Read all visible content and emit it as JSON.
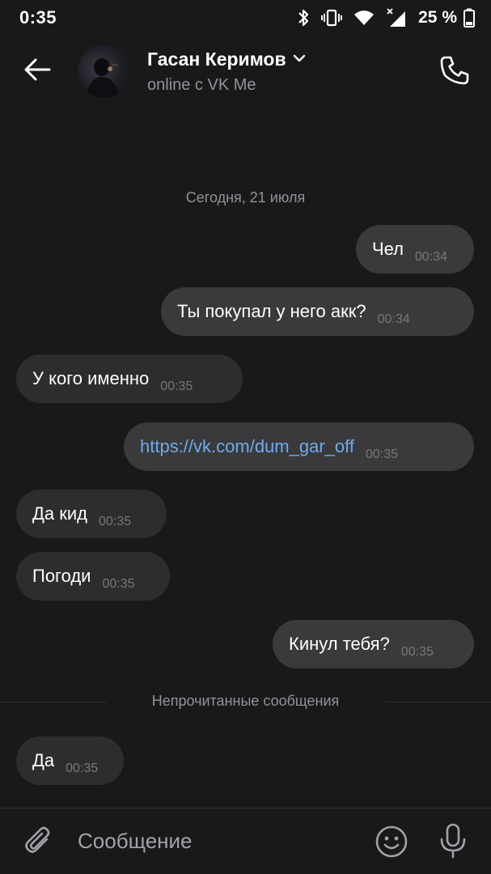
{
  "status_bar": {
    "time": "0:35",
    "battery_percent": "25 %",
    "icons": [
      "bluetooth-icon",
      "vibrate-icon",
      "wifi-icon",
      "cell-signal-icon",
      "battery-icon"
    ]
  },
  "header": {
    "contact_name": "Гасан Керимов",
    "contact_status": "online с VK Me",
    "icons": [
      "back-arrow-icon",
      "chevron-down-icon",
      "phone-icon"
    ]
  },
  "chat": {
    "date_separator": "Сегодня, 21 июля",
    "messages": [
      {
        "direction": "out",
        "text": "Чел",
        "time": "00:34"
      },
      {
        "direction": "out",
        "text": "Ты покупал у него акк?",
        "time": "00:34"
      },
      {
        "direction": "in",
        "text": "У кого именно",
        "time": "00:35"
      },
      {
        "direction": "out",
        "text": "https://vk.com/dum_gar_off",
        "time": "00:35",
        "is_link": true
      },
      {
        "direction": "in",
        "text": "Да кид",
        "time": "00:35"
      },
      {
        "direction": "in",
        "text": "Погоди",
        "time": "00:35"
      },
      {
        "direction": "out",
        "text": "Кинул тебя?",
        "time": "00:35"
      },
      {
        "direction": "in",
        "text": "Да",
        "time": "00:35"
      }
    ],
    "unread_separator": "Непрочитанные сообщения"
  },
  "composer": {
    "placeholder": "Сообщение",
    "value": "",
    "icons": [
      "paperclip-icon",
      "emoji-icon",
      "microphone-icon"
    ]
  },
  "colors": {
    "background": "#19191a",
    "bubble_incoming": "#2d2d2f",
    "bubble_outgoing": "#3a3a3c",
    "link": "#71aaeb",
    "secondary_text": "#8f9399"
  }
}
